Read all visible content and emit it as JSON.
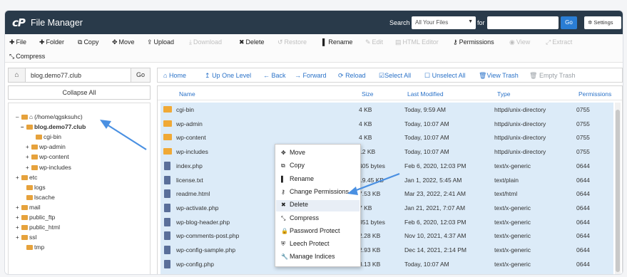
{
  "header": {
    "logo": "cP",
    "title": "File Manager",
    "search_label": "Search",
    "search_scope": "All Your Files",
    "for_label": "for",
    "search_value": "",
    "go_label": "Go",
    "settings_label": "Settings"
  },
  "toolbar": {
    "file": "File",
    "folder": "Folder",
    "copy": "Copy",
    "move": "Move",
    "upload": "Upload",
    "download": "Download",
    "delete": "Delete",
    "restore": "Restore",
    "rename": "Rename",
    "edit": "Edit",
    "html_editor": "HTML Editor",
    "permissions": "Permissions",
    "view": "View",
    "extract": "Extract",
    "compress": "Compress"
  },
  "left": {
    "path": "blog.demo77.club",
    "go": "Go",
    "collapse": "Collapse All",
    "tree": [
      {
        "label": "(/home/qgsksuhc)",
        "expander": "–",
        "home": true
      },
      {
        "label": "blog.demo77.club",
        "expander": "–",
        "bold": true
      },
      {
        "label": "cgi-bin",
        "expander": ""
      },
      {
        "label": "wp-admin",
        "expander": "+"
      },
      {
        "label": "wp-content",
        "expander": "+"
      },
      {
        "label": "wp-includes",
        "expander": "+"
      },
      {
        "label": "etc",
        "expander": "+"
      },
      {
        "label": "logs",
        "expander": ""
      },
      {
        "label": "lscache",
        "expander": ""
      },
      {
        "label": "mail",
        "expander": "+"
      },
      {
        "label": "public_ftp",
        "expander": "+"
      },
      {
        "label": "public_html",
        "expander": "+"
      },
      {
        "label": "ssl",
        "expander": "+"
      },
      {
        "label": "tmp",
        "expander": ""
      }
    ]
  },
  "nav": {
    "home": "Home",
    "up": "Up One Level",
    "back": "Back",
    "forward": "Forward",
    "reload": "Reload",
    "select_all": "Select All",
    "unselect_all": "Unselect All",
    "view_trash": "View Trash",
    "empty_trash": "Empty Trash"
  },
  "table": {
    "columns": [
      "Name",
      "Size",
      "Last Modified",
      "Type",
      "Permissions"
    ],
    "rows": [
      {
        "name": "cgi-bin",
        "size": "4 KB",
        "modified": "Today, 9:59 AM",
        "type": "httpd/unix-directory",
        "perms": "0755",
        "icon": "dir"
      },
      {
        "name": "wp-admin",
        "size": "4 KB",
        "modified": "Today, 10:07 AM",
        "type": "httpd/unix-directory",
        "perms": "0755",
        "icon": "dir"
      },
      {
        "name": "wp-content",
        "size": "4 KB",
        "modified": "Today, 10:07 AM",
        "type": "httpd/unix-directory",
        "perms": "0755",
        "icon": "dir"
      },
      {
        "name": "wp-includes",
        "size": "12 KB",
        "modified": "Today, 10:07 AM",
        "type": "httpd/unix-directory",
        "perms": "0755",
        "icon": "dir"
      },
      {
        "name": "index.php",
        "size": "405 bytes",
        "modified": "Feb 6, 2020, 12:03 PM",
        "type": "text/x-generic",
        "perms": "0644",
        "icon": "doc"
      },
      {
        "name": "license.txt",
        "size": "19.45 KB",
        "modified": "Jan 1, 2022, 5:45 AM",
        "type": "text/plain",
        "perms": "0644",
        "icon": "doc"
      },
      {
        "name": "readme.html",
        "size": "7.53 KB",
        "modified": "Mar 23, 2022, 2:41 AM",
        "type": "text/html",
        "perms": "0644",
        "icon": "doc"
      },
      {
        "name": "wp-activate.php",
        "size": "7 KB",
        "modified": "Jan 21, 2021, 7:07 AM",
        "type": "text/x-generic",
        "perms": "0644",
        "icon": "doc"
      },
      {
        "name": "wp-blog-header.php",
        "size": "351 bytes",
        "modified": "Feb 6, 2020, 12:03 PM",
        "type": "text/x-generic",
        "perms": "0644",
        "icon": "doc"
      },
      {
        "name": "wp-comments-post.php",
        "size": "2.28 KB",
        "modified": "Nov 10, 2021, 4:37 AM",
        "type": "text/x-generic",
        "perms": "0644",
        "icon": "doc"
      },
      {
        "name": "wp-config-sample.php",
        "size": "2.93 KB",
        "modified": "Dec 14, 2021, 2:14 PM",
        "type": "text/x-generic",
        "perms": "0644",
        "icon": "doc"
      },
      {
        "name": "wp-config.php",
        "size": "3.13 KB",
        "modified": "Today, 10:07 AM",
        "type": "text/x-generic",
        "perms": "0644",
        "icon": "doc"
      }
    ]
  },
  "context_menu": [
    {
      "label": "Move",
      "icon": "move-icon"
    },
    {
      "label": "Copy",
      "icon": "copy-icon"
    },
    {
      "label": "Rename",
      "icon": "rename-icon"
    },
    {
      "label": "Change Permissions",
      "icon": "key-icon"
    },
    {
      "label": "Delete",
      "icon": "x-icon"
    },
    {
      "label": "Compress",
      "icon": "compress-icon"
    },
    {
      "label": "Password Protect",
      "icon": "lock-icon"
    },
    {
      "label": "Leech Protect",
      "icon": "shield-icon"
    },
    {
      "label": "Manage Indices",
      "icon": "wrench-icon"
    }
  ],
  "colors": {
    "header_bg": "#293a4a",
    "accent": "#2a7dd4",
    "selection": "#dcebf8",
    "annotation_arrow": "#4a90e2"
  }
}
